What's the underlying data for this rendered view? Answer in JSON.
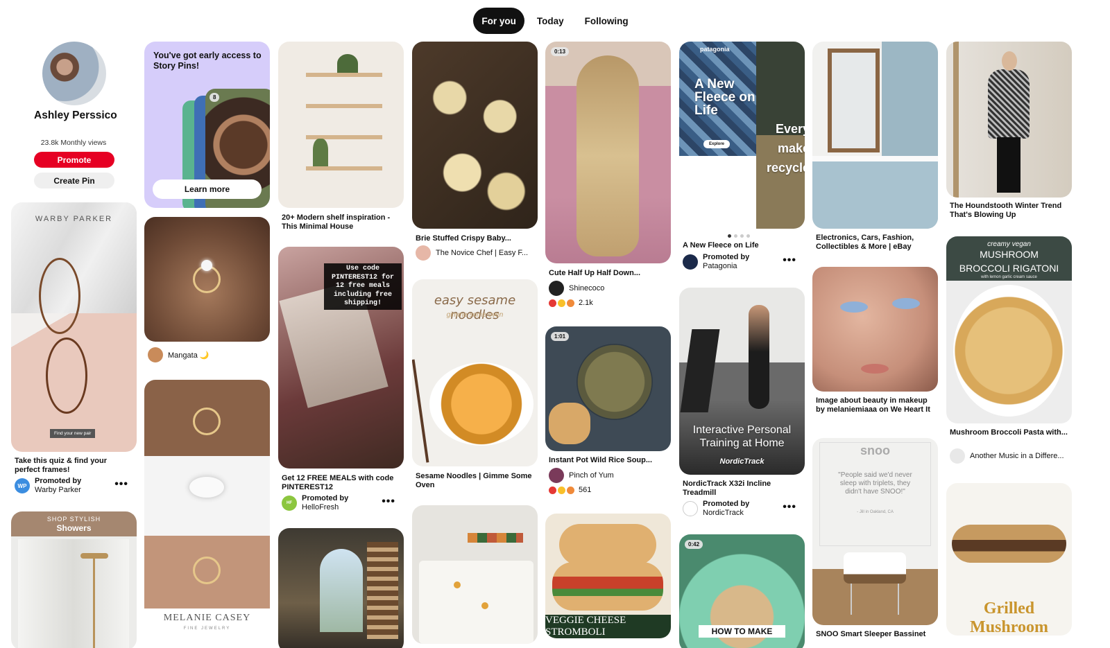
{
  "tabs": [
    {
      "label": "For you",
      "active": true
    },
    {
      "label": "Today",
      "active": false
    },
    {
      "label": "Following",
      "active": false
    }
  ],
  "profile": {
    "name": "Ashley Perssico",
    "views": "23.8k Monthly views",
    "promote_label": "Promote",
    "create_label": "Create Pin"
  },
  "col1": {
    "warby": {
      "brand": "WARBY PARKER",
      "cta": "Find your new pair",
      "title": "Take this quiz & find your perfect frames!",
      "promoted_by": "Promoted by",
      "advertiser": "Warby Parker",
      "avatar": "WP"
    },
    "showers": {
      "kicker": "SHOP STYLISH",
      "headline": "Showers"
    }
  },
  "col2": {
    "story": {
      "text": "You've got early access to Story Pins!",
      "badge": "8",
      "button": "Learn more"
    },
    "ring1": {
      "author": "Mangata 🌙"
    },
    "ring2": {
      "brand": "MELANIE CASEY",
      "sub": "FINE JEWELRY"
    }
  },
  "col3": {
    "shelf": {
      "title": "20+ Modern shelf inspiration - This Minimal House"
    },
    "hellofresh": {
      "overlay": "Use code PINTEREST12 for 12 free meals including free shipping!",
      "title": "Get 12 FREE MEALS with code PINTEREST12",
      "promoted_by": "Promoted by",
      "advertiser": "HelloFresh",
      "avatar": "HF"
    }
  },
  "col4": {
    "brie": {
      "title": "Brie Stuffed Crispy Baby...",
      "author": "The Novice Chef | Easy F..."
    },
    "noodles": {
      "overlay_title": "easy sesame noodles",
      "overlay_sub": "gimme some oven",
      "title": "Sesame Noodles | Gimme Some Oven"
    }
  },
  "col5": {
    "hair": {
      "badge": "0:13",
      "title": "Cute Half Up Half Down...",
      "author": "Shinecoco",
      "reactions": "2.1k"
    },
    "soup": {
      "badge": "1:01",
      "title": "Instant Pot Wild Rice Soup...",
      "author": "Pinch of Yum",
      "reactions": "561"
    },
    "stromboli": {
      "overlay": "VEGGIE CHEESE STROMBOLI"
    }
  },
  "col6": {
    "patagonia": {
      "brand": "patagonia",
      "headline": "A New Fleece on Life",
      "button": "Explore",
      "right_text": "Every make recycle",
      "title": "A New Fleece on Life",
      "promoted_by": "Promoted by",
      "advertiser": "Patagonia"
    },
    "nordic": {
      "overlay": "Interactive Personal Training at Home",
      "logo": "NordicTrack",
      "title": "NordicTrack X32i Incline Treadmill",
      "promoted_by": "Promoted by",
      "advertiser": "NordicTrack"
    },
    "tiktok": {
      "badge": "0:42",
      "overlay": "HOW TO MAKE"
    }
  },
  "col7": {
    "bathroom": {
      "title": "Electronics, Cars, Fashion, Collectibles & More | eBay"
    },
    "beauty": {
      "title": "Image about beauty in makeup by melaniemiaaa on We Heart It"
    },
    "snoo": {
      "logo": "snoo",
      "quote": "\"People said we'd never sleep with triplets, they didn't have SNOO!\"",
      "attribution": "- Jill in Oakland, CA",
      "title": "SNOO Smart Sleeper Bassinet"
    }
  },
  "col8": {
    "outfit": {
      "title": "The Houndstooth Winter Trend That's Blowing Up"
    },
    "pasta": {
      "kicker": "creamy vegan",
      "headline1": "MUSHROOM",
      "headline2": "BROCCOLI RIGATONI",
      "sub": "with lemon garlic cream sauce",
      "title": "Mushroom Broccoli Pasta with...",
      "author": "Another Music in a Differe..."
    },
    "mushroom": {
      "overlay": "Grilled Mushroom"
    }
  },
  "colors": {
    "accent": "#e60023",
    "text": "#111111"
  }
}
